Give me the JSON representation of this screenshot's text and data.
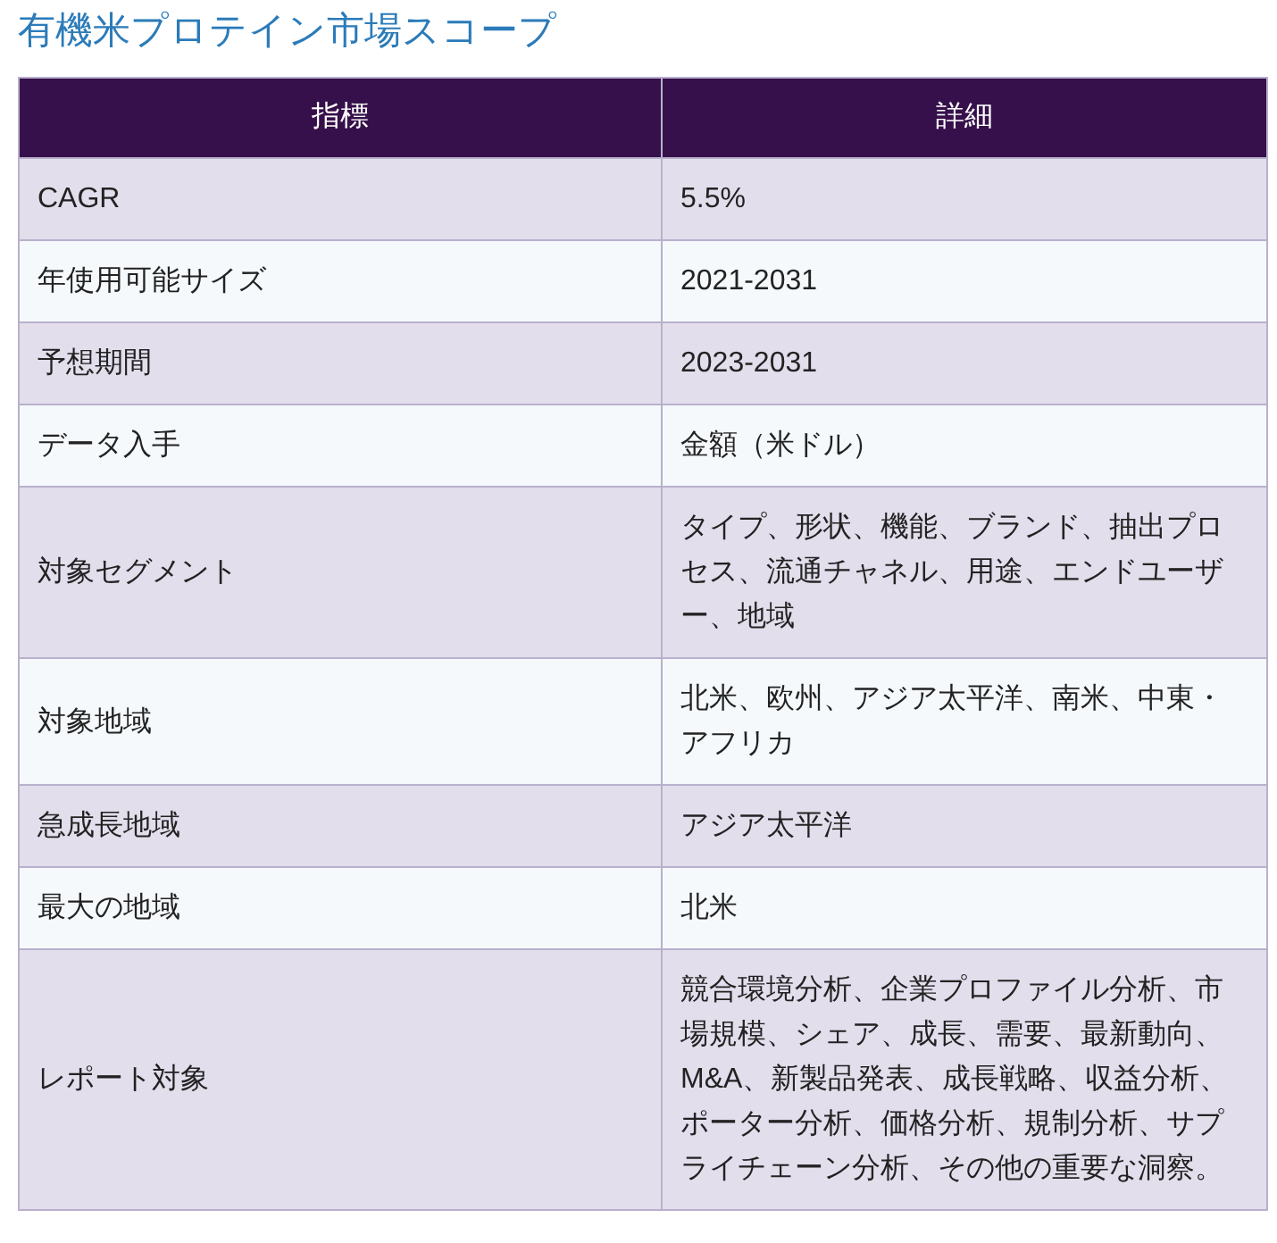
{
  "title": "有機米プロテイン市場スコープ",
  "table": {
    "columns": [
      "指標",
      "詳細"
    ],
    "rows": [
      [
        "CAGR",
        "5.5%"
      ],
      [
        "年使用可能サイズ",
        "2021-2031"
      ],
      [
        "予想期間",
        "2023-2031"
      ],
      [
        "データ入手",
        "金額（米ドル）"
      ],
      [
        "対象セグメント",
        "タイプ、形状、機能、ブランド、抽出プロセス、流通チャネル、用途、エンドユーザー、地域"
      ],
      [
        "対象地域",
        "北米、欧州、アジア太平洋、南米、中東・アフリカ"
      ],
      [
        "急成長地域",
        "アジア太平洋"
      ],
      [
        "最大の地域",
        "北米"
      ],
      [
        "レポート対象",
        "競合環境分析、企業プロファイル分析、市場規模、シェア、成長、需要、最新動向、M&A、新製品発表、成長戦略、収益分析、ポーター分析、価格分析、規制分析、サプライチェーン分析、その他の重要な洞察。"
      ]
    ]
  }
}
